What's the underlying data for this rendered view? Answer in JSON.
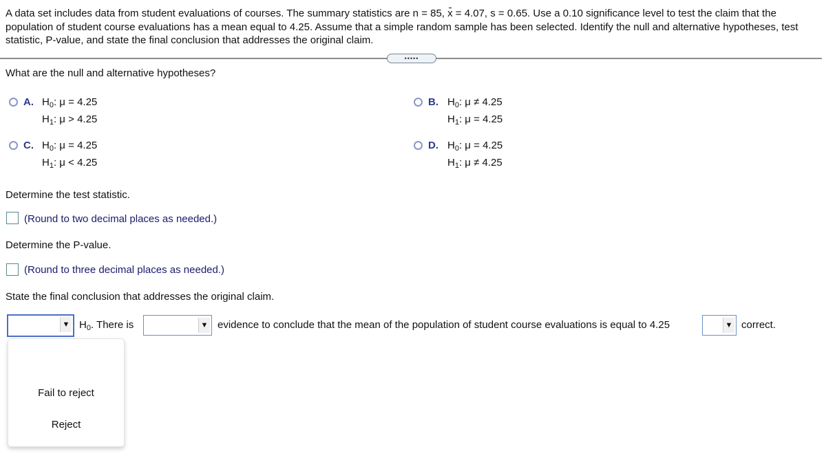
{
  "problem": {
    "text_part1": "A data set includes data from student evaluations of courses. The summary statistics are n = 85, ",
    "xbar_symbol": "x",
    "text_part2": " = 4.07, s = 0.65. Use a 0.10 significance level to test the claim that the population of student course evaluations has a mean equal to 4.25. Assume that a simple random sample has been selected. Identify the null and alternative hypotheses, test statistic, P-value, and state the final conclusion that addresses the original claim."
  },
  "expand_button": {
    "label": "•••••"
  },
  "hypotheses_question": "What are the null and alternative hypotheses?",
  "options": [
    {
      "letter": "A.",
      "h0_rel": "=",
      "h1_rel": ">",
      "value": "4.25"
    },
    {
      "letter": "B.",
      "h0_rel": "≠",
      "h1_rel": "=",
      "value": "4.25"
    },
    {
      "letter": "C.",
      "h0_rel": "=",
      "h1_rel": "<",
      "value": "4.25"
    },
    {
      "letter": "D.",
      "h0_rel": "=",
      "h1_rel": "≠",
      "value": "4.25"
    }
  ],
  "symbols": {
    "H": "H",
    "sub0": "0",
    "sub1": "1",
    "colon_mu": ": μ"
  },
  "test_statistic": {
    "question": "Determine the test statistic.",
    "value": "",
    "hint": "(Round to two decimal places as needed.)"
  },
  "p_value": {
    "question": "Determine the P-value.",
    "value": "",
    "hint": "(Round to three decimal places as needed.)"
  },
  "conclusion": {
    "question": "State the final conclusion that addresses the original claim.",
    "select1_value": "",
    "text_h0": "H",
    "text_h0_sub": "0",
    "text_after_h0": ". There is",
    "select2_value": "",
    "text_middle": "evidence to conclude that the mean of the population of student course evaluations is equal to 4.25",
    "select3_value": "",
    "text_end": "correct.",
    "dropdown_arrow": "▼",
    "dropdown_options": [
      "Fail to reject",
      "Reject"
    ]
  },
  "colors": {
    "option_letter": "#2b3a8a",
    "hint_text": "#1a1a6e",
    "radio_border": "#8a98c8",
    "select_border": "#4a6fc4"
  }
}
